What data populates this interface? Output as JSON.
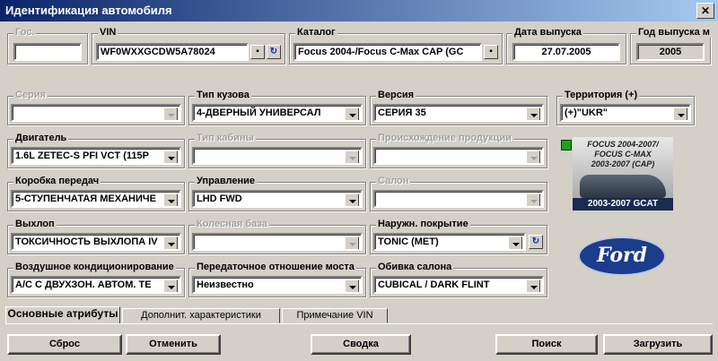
{
  "window": {
    "title": "Идентификация автомобиля",
    "close": "✕"
  },
  "header": {
    "gos": {
      "label": "Гос.",
      "value": ""
    },
    "vin": {
      "label": "VIN",
      "value": "WF0WXXGCDW5A78024"
    },
    "catalog": {
      "label": "Каталог",
      "value": "Focus 2004-/Focus C-Max CAP (GC"
    },
    "release_date": {
      "label": "Дата выпуска",
      "value": "27.07.2005"
    },
    "release_year": {
      "label": "Год выпуска м",
      "value": "2005"
    }
  },
  "attributes": {
    "series": {
      "label": "Серия",
      "value": ""
    },
    "body_type": {
      "label": "Тип кузова",
      "value": "4-ДВЕРНЫЙ УНИВЕРСАЛ"
    },
    "version": {
      "label": "Версия",
      "value": "СЕРИЯ 35"
    },
    "territory": {
      "label": "Территория (+)",
      "value": "(+)\"UKR\""
    },
    "engine": {
      "label": "Двигатель",
      "value": "1.6L ZETEC-S PFI VCT (115P"
    },
    "cab_type": {
      "label": "Тип кабины",
      "value": ""
    },
    "origin": {
      "label": "Происхождение продукции",
      "value": ""
    },
    "gearbox": {
      "label": "Коробка передач",
      "value": "5-СТУПЕНЧАТАЯ МЕХАНИЧЕ"
    },
    "steering": {
      "label": "Управление",
      "value": "LHD FWD"
    },
    "salon": {
      "label": "Салон",
      "value": ""
    },
    "exhaust": {
      "label": "Выхлоп",
      "value": "ТОКСИЧНОСТЬ ВЫХЛОПА IV"
    },
    "wheelbase": {
      "label": "Колесная база",
      "value": ""
    },
    "paint": {
      "label": "Наружн. покрытие",
      "value": "TONIC (MET)"
    },
    "ac": {
      "label": "Воздушное кондиционирование",
      "value": "A/C С ДВУХЗОН. АВТОМ. ТЕ"
    },
    "gear_ratio": {
      "label": "Передаточное отношение моста",
      "value": "Неизвестно"
    },
    "upholstery": {
      "label": "Обивка салона",
      "value": "CUBICAL / DARK FLINT"
    }
  },
  "thumbnail": {
    "lines": [
      "FOCUS 2004-2007/",
      "FOCUS C-MAX",
      "2003-2007 (CAP)"
    ],
    "bar": "2003-2007 GCAT"
  },
  "logo": {
    "text": "Ford"
  },
  "tabs": [
    "Основные атрибуты",
    "Дополнит. характеристики",
    "Примечание VIN"
  ],
  "buttons": {
    "reset": "Сброс",
    "cancel": "Отменить",
    "summary": "Сводка",
    "search": "Поиск",
    "load": "Загрузить"
  },
  "colors": {
    "title_start": "#0a246a",
    "title_end": "#a6caf0",
    "face": "#d4d0c8"
  }
}
